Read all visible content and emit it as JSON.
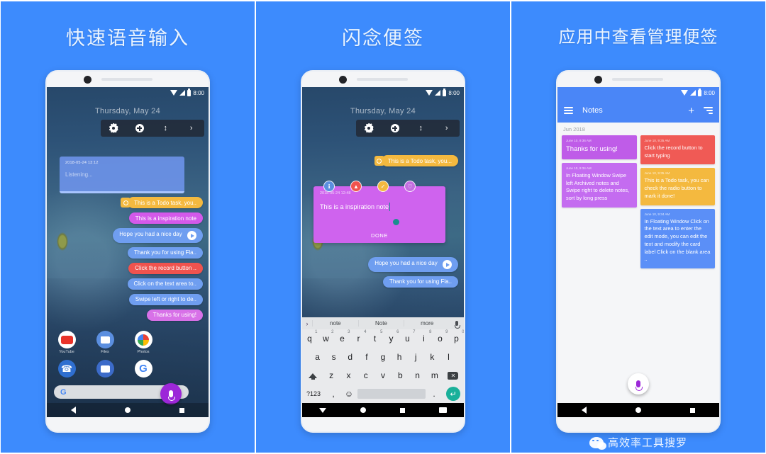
{
  "panels": [
    {
      "title": "快速语音输入",
      "status": {
        "time": "8:00",
        "wifi": "wifi-icon",
        "signal": "signal-icon",
        "battery": "battery-icon"
      },
      "floating": {
        "date": "Thursday, May 24",
        "toolbar": [
          "settings-gear",
          "add-plus",
          "resize-updown",
          "collapse-chevron"
        ],
        "listening_card": {
          "time": "2018-05-24 13:12",
          "text": "Listening..."
        }
      },
      "bubbles": [
        {
          "text": "This is a Todo task, you..",
          "color": "todo",
          "icon": "radio-icon"
        },
        {
          "text": "This is a  inspiration note",
          "color": "insp"
        },
        {
          "text": "Hope you had a nice day",
          "color": "blue",
          "play": true
        },
        {
          "text": "Thank you for using Fla..",
          "color": "blue"
        },
        {
          "text": "Click the record button ..",
          "color": "red"
        },
        {
          "text": "Click on the text area to..",
          "color": "blue"
        },
        {
          "text": "Swipe left or right to de..",
          "color": "blue"
        },
        {
          "text": "Thanks for using!",
          "color": "pink"
        }
      ],
      "home": {
        "row1": [
          {
            "label": "YouTube",
            "icon": "youtube-icon"
          },
          {
            "label": "Files",
            "icon": "files-icon"
          },
          {
            "label": "Photos",
            "icon": "photos-icon"
          }
        ],
        "row2": [
          {
            "label": "",
            "icon": "phone-icon"
          },
          {
            "label": "",
            "icon": "messages-icon"
          },
          {
            "label": "",
            "icon": "google-icon"
          }
        ],
        "search_placeholder": "",
        "search_logo": "G",
        "fab": "mic-icon"
      },
      "nav": [
        "back-button",
        "home-button",
        "recents-button"
      ]
    },
    {
      "title": "闪念便签",
      "status": {
        "time": "8:00"
      },
      "floating": {
        "date": "Thursday, May 24",
        "toolbar": [
          "settings-gear",
          "add-plus",
          "resize-updown",
          "collapse-chevron"
        ]
      },
      "todo_bubble": "This is a Todo task, you...",
      "actions": [
        "ℹ",
        "▲",
        "✓",
        "♡"
      ],
      "edit_card": {
        "time": "2018-05-24 12:48",
        "text": "This is a  inspiration note",
        "done_label": "DONE"
      },
      "bubbles": [
        {
          "text": "Hope you had a nice day",
          "color": "blue",
          "play": true
        },
        {
          "text": "Thank you for using Fla..",
          "color": "blue"
        }
      ],
      "keyboard": {
        "suggestions": [
          "note",
          "Note",
          "more"
        ],
        "expand_icon": "chevron-right-icon",
        "mic_icon": "mic-icon",
        "row1": [
          {
            "k": "q",
            "n": "1"
          },
          {
            "k": "w",
            "n": "2"
          },
          {
            "k": "e",
            "n": "3"
          },
          {
            "k": "r",
            "n": "4"
          },
          {
            "k": "t",
            "n": "5"
          },
          {
            "k": "y",
            "n": "6"
          },
          {
            "k": "u",
            "n": "7"
          },
          {
            "k": "i",
            "n": "8"
          },
          {
            "k": "o",
            "n": "9"
          },
          {
            "k": "p",
            "n": "0"
          }
        ],
        "row2": [
          "a",
          "s",
          "d",
          "f",
          "g",
          "h",
          "j",
          "k",
          "l"
        ],
        "row3": [
          "z",
          "x",
          "c",
          "v",
          "b",
          "n",
          "m"
        ],
        "sym_key": "?123",
        "comma_key": ",",
        "emoji_key": "☺",
        "period_key": ".",
        "enter_key": "↵"
      },
      "nav": [
        "back-button",
        "home-button",
        "recents-button",
        "keyboard-button"
      ]
    },
    {
      "title": "应用中查看管理便签",
      "status": {
        "time": "8:00"
      },
      "appbar": {
        "menu": "hamburger-icon",
        "title": "Notes",
        "add": "+",
        "sort": "sort-icon"
      },
      "month_header": "Jun 2018",
      "notes_left": [
        {
          "time": "June 10, 9:36 AM",
          "text": "Thanks for using!",
          "color": "c-purple",
          "big": true
        },
        {
          "time": "June 10, 9:34 AM",
          "text": "In Floating Window Swipe left Archived notes and Swipe right to delete notes, sort by long press",
          "color": "c-violet"
        }
      ],
      "notes_right": [
        {
          "time": "June 10, 9:35 AM",
          "text": "Click the record button to start typing",
          "color": "c-red"
        },
        {
          "time": "June 10, 9:35 AM",
          "text": "This is a Todo task, you can check the radio button to mark it done!",
          "color": "c-yellow"
        },
        {
          "time": "June 10, 9:34 AM",
          "text": "In Floating Window Click on the text area to enter the edit mode, you can edit the text and modify the card label Click on the blank area ..",
          "color": "c-blue"
        }
      ],
      "fab": "mic-icon",
      "nav": [
        "back-button",
        "home-button",
        "recents-button"
      ]
    }
  ],
  "watermark": {
    "logo": "wechat-icon",
    "text": "高效率工具搜罗"
  },
  "theme": {
    "background": "#3d8bfd",
    "accent": "#4a86f7",
    "mic_purple": "#9c27d8"
  }
}
